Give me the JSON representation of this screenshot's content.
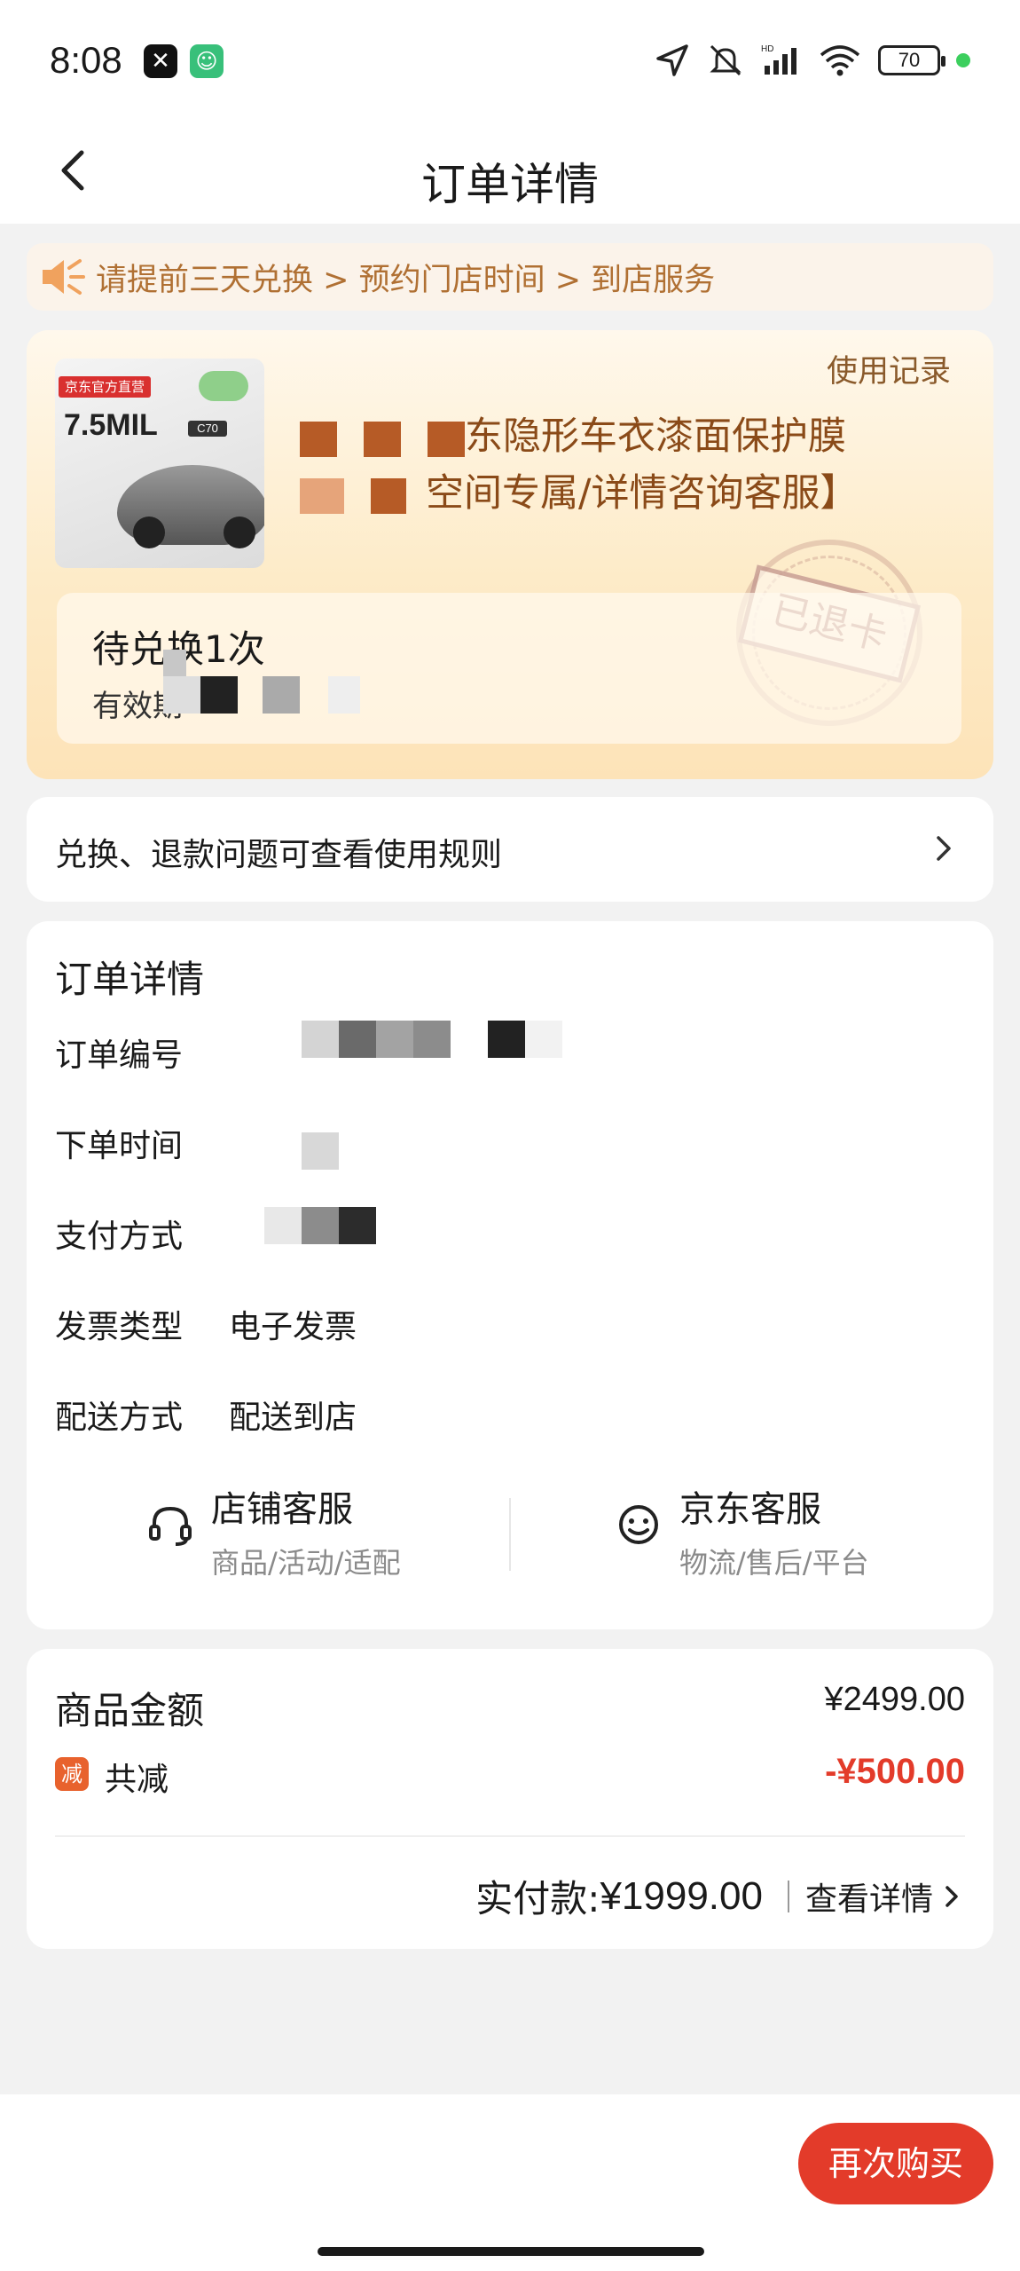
{
  "status_bar": {
    "time": "8:08",
    "battery": "70",
    "icons": [
      "location-icon",
      "mute-icon",
      "signal-icon",
      "wifi-icon",
      "battery-icon"
    ]
  },
  "nav": {
    "title": "订单详情",
    "back_icon": "chevron-left-icon"
  },
  "notice": {
    "text": "请提前三天兑换 > 预约门店时间 > 到店服务",
    "icon": "speaker-icon"
  },
  "product": {
    "use_record": "使用记录",
    "title_line1": "东隐形车衣漆面保护膜",
    "title_line2": "空间专属/详情咨询客服】",
    "thumb_badge": "京东官方直营",
    "thumb_mil": "7.5MIL",
    "thumb_model": "C70",
    "pending": "待兑换1次",
    "validity_label": "有效期",
    "stamp_text": "已退卡"
  },
  "rules": {
    "text": "兑换、退款问题可查看使用规则"
  },
  "order_detail": {
    "title": "订单详情",
    "rows": [
      {
        "label": "订单编号",
        "value": ""
      },
      {
        "label": "下单时间",
        "value": ""
      },
      {
        "label": "支付方式",
        "value": ""
      },
      {
        "label": "发票类型",
        "value": "电子发票"
      },
      {
        "label": "配送方式",
        "value": "配送到店"
      }
    ],
    "services": [
      {
        "name": "店铺客服",
        "sub": "商品/活动/适配",
        "icon": "headset-icon"
      },
      {
        "name": "京东客服",
        "sub": "物流/售后/平台",
        "icon": "smiley-icon"
      }
    ]
  },
  "amount": {
    "goods_label": "商品金额",
    "goods_value": "¥2499.00",
    "reduce_badge": "减",
    "reduce_label": "共减",
    "reduce_value": "-¥500.00",
    "paid_label": "实付款:",
    "paid_value": "¥1999.00",
    "view_detail": "查看详情"
  },
  "footer": {
    "rebuy": "再次购买"
  },
  "colors": {
    "accent_red": "#e33b2a",
    "notice_text": "#b07033",
    "card_gradient_end": "#fde3b8"
  }
}
